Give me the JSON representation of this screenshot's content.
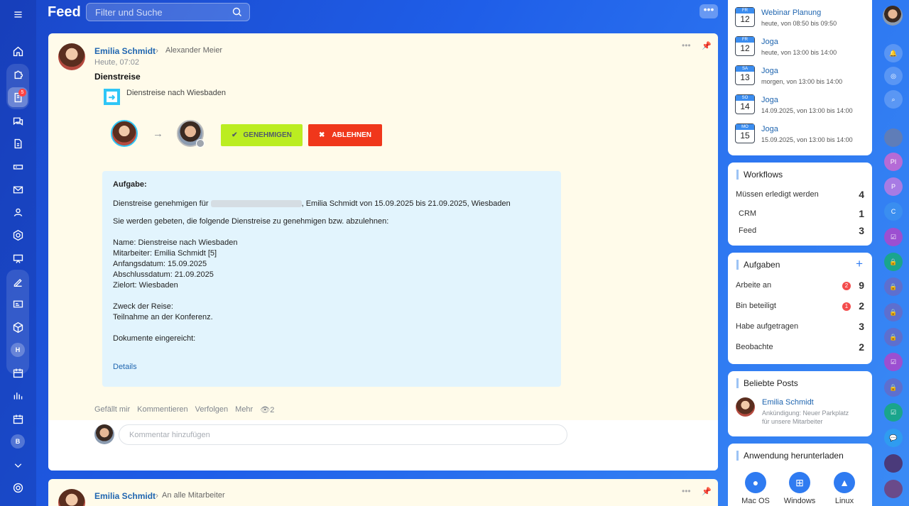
{
  "header": {
    "title": "Feed",
    "search_placeholder": "Filter und Suche",
    "more_label": "•••"
  },
  "left_sidebar": {
    "badge": "5",
    "avatar_letters": [
      "H",
      "B"
    ]
  },
  "post": {
    "author": "Emilia Schmidt",
    "recipient": "Alexander Meier",
    "time": "Heute, 07:02",
    "title": "Dienstreise",
    "subtitle": "Dienstreise nach Wiesbaden",
    "approve_label": "GENEHMIGEN",
    "reject_label": "ABLEHNEN",
    "task": {
      "heading": "Aufgabe:",
      "line1_prefix": "Dienstreise genehmigen für",
      "line1_suffix": ", Emilia Schmidt von 15.09.2025 bis 21.09.2025, Wiesbaden",
      "line2": "Sie werden gebeten, die folgende Dienstreise zu genehmigen bzw. abzulehnen:",
      "name": "Name: Dienstreise nach Wiesbaden",
      "employee": "Mitarbeiter: Emilia Schmidt [5]",
      "start": "Anfangsdatum: 15.09.2025",
      "end": "Abschlussdatum: 21.09.2025",
      "destination": "Zielort: Wiesbaden",
      "purpose_label": "Zweck der Reise:",
      "purpose": "Teilnahme an der Konferenz.",
      "docs": "Dokumente eingereicht:",
      "details_link": "Details"
    },
    "actions": {
      "like": "Gefällt mir",
      "comment": "Kommentieren",
      "follow": "Verfolgen",
      "more": "Mehr",
      "views": "2"
    },
    "comment_placeholder": "Kommentar hinzufügen"
  },
  "post2": {
    "author": "Emilia Schmidt",
    "recipient": "An alle Mitarbeiter"
  },
  "events": [
    {
      "dow": "FR",
      "day": "12",
      "title": "Webinar Planung",
      "time": "heute, von 08:50 bis 09:50"
    },
    {
      "dow": "FR",
      "day": "12",
      "title": "Joga",
      "time": "heute, von 13:00 bis 14:00"
    },
    {
      "dow": "SA",
      "day": "13",
      "title": "Joga",
      "time": "morgen, von 13:00 bis 14:00"
    },
    {
      "dow": "SO",
      "day": "14",
      "title": "Joga",
      "time": "14.09.2025, von 13:00 bis 14:00"
    },
    {
      "dow": "MO",
      "day": "15",
      "title": "Joga",
      "time": "15.09.2025, von 13:00 bis 14:00"
    }
  ],
  "workflows": {
    "title": "Workflows",
    "rows": [
      {
        "label": "Müssen erledigt werden",
        "count": "4"
      },
      {
        "label": "CRM",
        "count": "1"
      },
      {
        "label": "Feed",
        "count": "3"
      }
    ]
  },
  "tasks": {
    "title": "Aufgaben",
    "add": "+",
    "rows": [
      {
        "label": "Arbeite an",
        "badge": "2",
        "count": "9"
      },
      {
        "label": "Bin beteiligt",
        "badge": "1",
        "count": "2"
      },
      {
        "label": "Habe aufgetragen",
        "badge": "",
        "count": "3"
      },
      {
        "label": "Beobachte",
        "badge": "",
        "count": "2"
      }
    ]
  },
  "popular": {
    "title": "Beliebte Posts",
    "author": "Emilia Schmidt",
    "text1": "Ankündigung: Neuer Parkplatz",
    "text2": "für unsere Mitarbeiter"
  },
  "download": {
    "title": "Anwendung herunterladen",
    "items": [
      "Mac OS",
      "Windows",
      "Linux"
    ]
  },
  "right_rail": {
    "letters": [
      "PI",
      "P",
      "C"
    ]
  },
  "colors": {
    "approve": "#bbed21",
    "reject": "#f0371b",
    "link": "#2066b0",
    "card_bg": "#fffbea",
    "task_bg": "#e2f4fd"
  }
}
